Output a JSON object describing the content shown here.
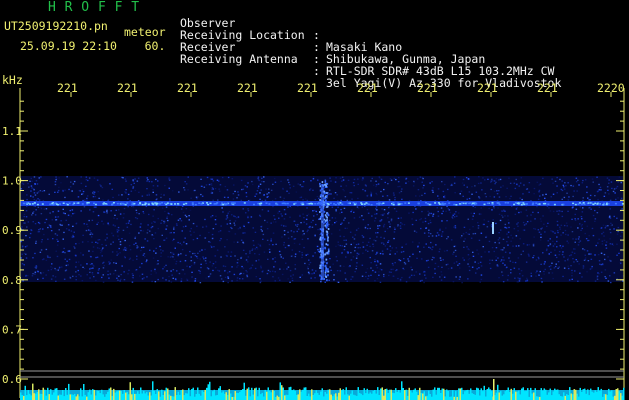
{
  "header": {
    "brand": "H R O F F T",
    "filename": "UT2509192210.pn",
    "file_tag": "meteor",
    "datetime": "25.09.19 22:10    60."
  },
  "station": [
    {
      "label": "Observer",
      "value": "Masaki Kano"
    },
    {
      "label": "Receiving Location",
      "value": "Shibukawa, Gunma, Japan"
    },
    {
      "label": "Receiver",
      "value": "RTL-SDR SDR# 43dB L15 103.2MHz CW"
    },
    {
      "label": "Receiving Antenna",
      "value": "3el Yagi(V) Az 330 for Vladivostok"
    }
  ],
  "separator": ":",
  "axis": {
    "unit": "kHz",
    "y_ticks": [
      "1.1",
      "1.0",
      "0.9",
      "0.8",
      "0.7",
      "0.6"
    ],
    "x_ticks": [
      "221",
      "221",
      "221",
      "221",
      "221",
      "221",
      "221",
      "221",
      "221",
      "2220"
    ]
  },
  "colors": {
    "axis": "#f0f070",
    "text": "#f2f2f2",
    "brand": "#22c04a",
    "signal": "#2a5cff",
    "noise_base": "#0b1a6e",
    "spectrum": "#00e5ff"
  }
}
